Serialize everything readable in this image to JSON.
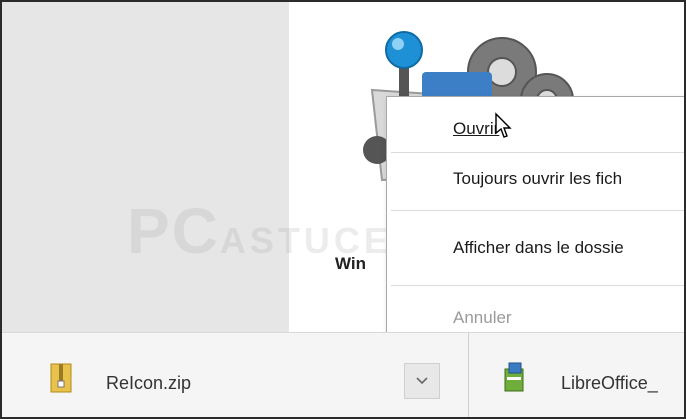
{
  "context_menu": {
    "items": [
      {
        "label": "Ouvrir",
        "enabled": true
      },
      {
        "label": "Toujours ouvrir les fich",
        "enabled": true
      },
      {
        "label": "Afficher dans le dossie",
        "enabled": true
      },
      {
        "label": "Annuler",
        "enabled": false
      }
    ]
  },
  "page": {
    "app_name_partial": "Win",
    "watermark_primary": "PC",
    "watermark_secondary": "ASTUCES"
  },
  "downloads": {
    "items": [
      {
        "name": "ReIcon.zip",
        "icon": "zip-archive-icon"
      },
      {
        "name": "LibreOffice_",
        "icon": "installer-icon"
      }
    ],
    "menu_button_icon": "chevron-down-icon"
  },
  "colors": {
    "accent_ball": "#1e90d6",
    "left_pane": "#e6e6e6",
    "download_bar": "#f5f5f5"
  }
}
